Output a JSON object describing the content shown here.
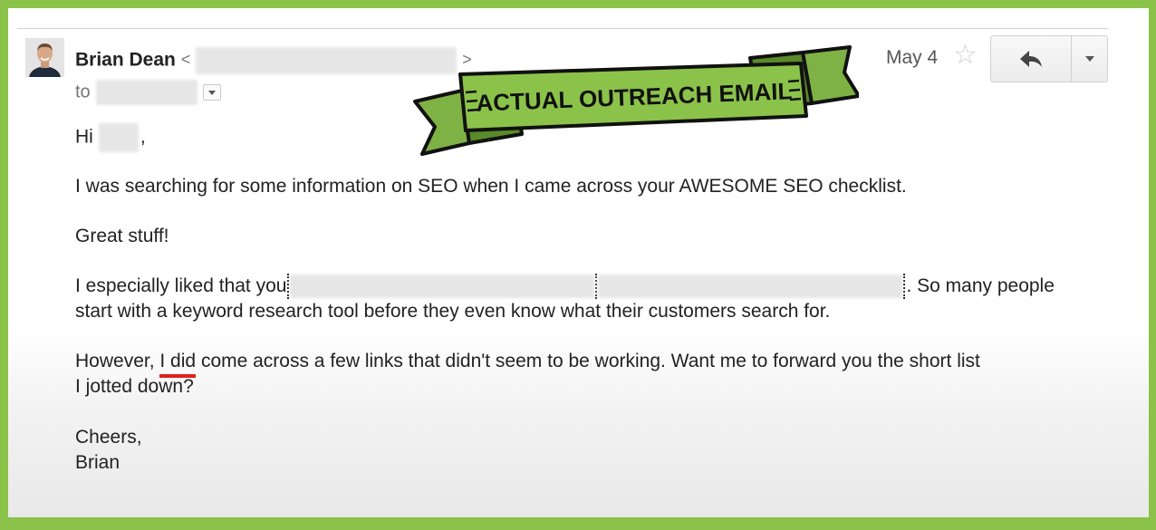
{
  "email": {
    "sender_name": "Brian Dean",
    "sender_open": "<",
    "sender_close": ">",
    "to_label": "to",
    "date": "May 4",
    "greeting": "Hi",
    "greeting_punct": ",",
    "p1": "I was searching for some information on SEO when I came across your AWESOME SEO checklist.",
    "p2": "Great stuff!",
    "p3_start": "I especially liked that you",
    "p3_end": ". So many people",
    "p3_line2": "start with a keyword research tool before they even know what their customers search for.",
    "p4_start": "However,",
    "p4_underlined": "I did",
    "p4_rest": "come across a few links that didn't seem to be working. Want me to forward you the short list",
    "p4_line2": "I jotted down?",
    "signoff": "Cheers,",
    "signature": "Brian"
  },
  "banner": {
    "text": "ACTUAL OUTREACH EMAIL"
  },
  "icons": {
    "star": "star-outline-icon",
    "reply": "reply-arrow-icon",
    "more": "chevron-down-icon",
    "recipients": "dropdown-caret-icon"
  },
  "colors": {
    "frame": "#8bc34a",
    "ribbon": "#8bc34a",
    "underline": "#e0201c"
  }
}
